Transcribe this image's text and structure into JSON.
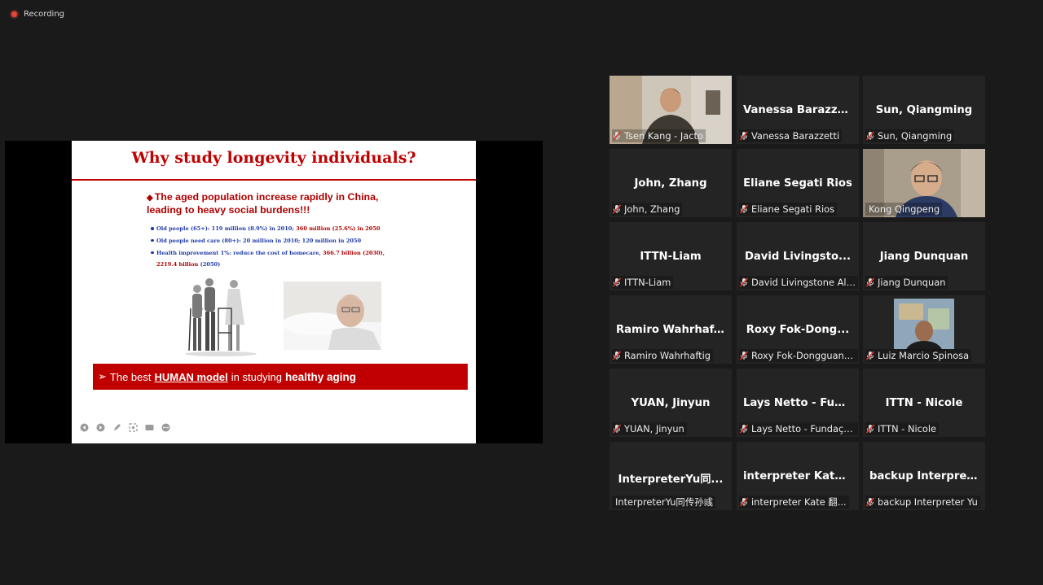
{
  "recording": {
    "label": "Recording"
  },
  "slide": {
    "title": "Why study longevity individuals?",
    "headline": "The aged population increase rapidly in China, leading to heavy social burdens!!!",
    "bullet1_blue": "Old people (65+): 119 million (8.9%) in 2010; ",
    "bullet1_red": "360 million (25.6%) in 2050",
    "bullet2_blue": "Old people need care (80+): 20 million in 2010; 120 million in 2050",
    "bullet3_blue": "Health improvement 1%: reduce the cost of homecare, ",
    "bullet3_red": "366.7 billion (2030), 2219.4 billion ",
    "bullet3_end": "(2050)",
    "banner_prefix": "The best",
    "banner_bold": "HUMAN model",
    "banner_mid": "in studying",
    "banner_end": "healthy aging"
  },
  "participants": [
    {
      "name": "Tsen Kang - Jacto",
      "label": "Tsen Kang - Jacto",
      "video": true,
      "muted": true
    },
    {
      "name": "Vanessa  Barazze...",
      "label": "Vanessa Barazzetti",
      "video": false,
      "muted": true
    },
    {
      "name": "Sun, Qiangming",
      "label": "Sun, Qiangming",
      "video": false,
      "muted": true
    },
    {
      "name": "John, Zhang",
      "label": "John, Zhang",
      "video": false,
      "muted": true
    },
    {
      "name": "Eliane Segati Rios",
      "label": "Eliane Segati Rios",
      "video": false,
      "muted": true
    },
    {
      "name": "Kong Qingpeng",
      "label": "Kong Qingpeng",
      "video": true,
      "muted": false,
      "active": true
    },
    {
      "name": "ITTN-Liam",
      "label": "ITTN-Liam",
      "video": false,
      "muted": true
    },
    {
      "name": "David  Livingsto...",
      "label": "David Livingstone Alv...",
      "video": false,
      "muted": true
    },
    {
      "name": "Jiang Dunquan",
      "label": "Jiang Dunquan",
      "video": false,
      "muted": true
    },
    {
      "name": "Ramiro  Wahrhaf...",
      "label": "Ramiro Wahrhaftig",
      "video": false,
      "muted": true
    },
    {
      "name": "Roxy  Fok-Dong...",
      "label": "Roxy Fok-Dongguan ...",
      "video": false,
      "muted": true
    },
    {
      "name": "Luiz Marcio Spinosa",
      "label": "Luiz Marcio Spinosa",
      "video": true,
      "muted": true
    },
    {
      "name": "YUAN, Jinyun",
      "label": "YUAN, Jinyun",
      "video": false,
      "muted": true
    },
    {
      "name": "Lays Netto - Fun...",
      "label": "Lays Netto - Fundaçã...",
      "video": false,
      "muted": true
    },
    {
      "name": "ITTN - Nicole",
      "label": "ITTN - Nicole",
      "video": false,
      "muted": true
    },
    {
      "name": "InterpreterYu同...",
      "label": "InterpreterYu同传孙彧",
      "video": false,
      "muted": false
    },
    {
      "name": "interpreter  Kate...",
      "label": "interpreter Kate 翻...",
      "video": false,
      "muted": true
    },
    {
      "name": "backup  Interpre...",
      "label": "backup Interpreter Yu",
      "video": false,
      "muted": true
    }
  ]
}
